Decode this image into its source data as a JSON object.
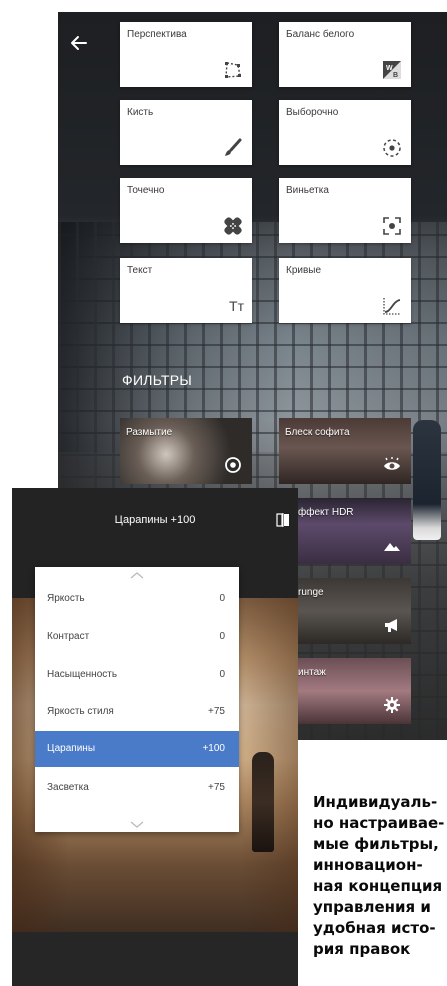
{
  "tools": [
    {
      "label": "Перспектива",
      "icon": "perspective-icon"
    },
    {
      "label": "Баланс белого",
      "icon": "white-balance-icon"
    },
    {
      "label": "Кисть",
      "icon": "brush-icon"
    },
    {
      "label": "Выборочно",
      "icon": "selective-icon"
    },
    {
      "label": "Точечно",
      "icon": "healing-icon"
    },
    {
      "label": "Виньетка",
      "icon": "vignette-icon"
    },
    {
      "label": "Текст",
      "icon": "text-icon"
    },
    {
      "label": "Кривые",
      "icon": "curves-icon"
    }
  ],
  "tools_icon_text": {
    "text_icon_glyph": "Tт"
  },
  "filters": {
    "header": "ФИЛЬТРЫ",
    "items": [
      {
        "label": "Размытие",
        "icon": "target-icon"
      },
      {
        "label": "Блеск софита",
        "icon": "eye-icon"
      },
      {
        "label": "ффект HDR",
        "icon": "mountain-icon"
      },
      {
        "label": "runge",
        "icon": "megaphone-icon"
      },
      {
        "label": "интаж",
        "icon": "gear-icon"
      }
    ]
  },
  "editor": {
    "title": "Царапины +100",
    "compare_icon": "compare-icon",
    "menu": [
      {
        "name": "Яркость",
        "value": "0"
      },
      {
        "name": "Контраст",
        "value": "0"
      },
      {
        "name": "Насыщенность",
        "value": "0"
      },
      {
        "name": "Яркость стиля",
        "value": "+75"
      },
      {
        "name": "Царапины",
        "value": "+100",
        "selected": true
      },
      {
        "name": "Засветка",
        "value": "+75"
      }
    ]
  },
  "caption": "Индивидуаль-\nно настраивае-\nмые фильтры,\nинновацион-\nная концепция\nуправления и\nудобная исто-\nрия правок",
  "colors": {
    "selected_row": "#4a7bc9",
    "dark_bar": "#232323"
  }
}
